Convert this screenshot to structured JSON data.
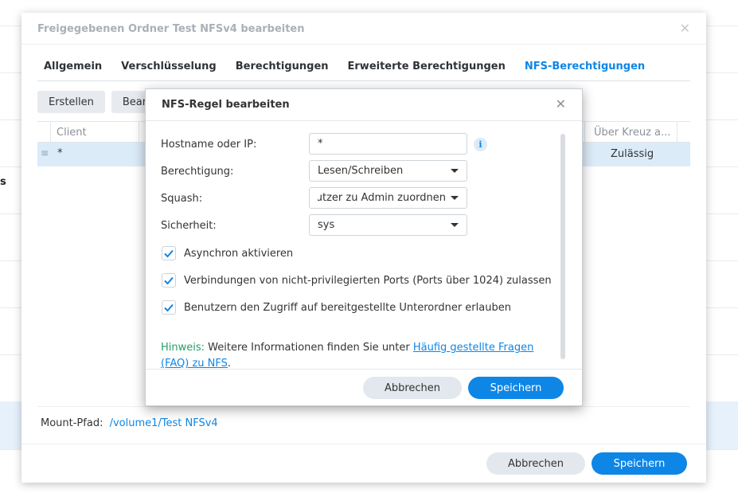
{
  "background": {
    "edge_text": "s"
  },
  "outer_dialog": {
    "title": "Freigegebenen Ordner Test NFSv4 bearbeiten",
    "close_glyph": "✕",
    "tabs": [
      {
        "label": "Allgemein",
        "active": false
      },
      {
        "label": "Verschlüsselung",
        "active": false
      },
      {
        "label": "Berechtigungen",
        "active": false
      },
      {
        "label": "Erweiterte Berechtigungen",
        "active": false
      },
      {
        "label": "NFS-Berechtigungen",
        "active": true
      }
    ],
    "toolbar": {
      "create_label": "Erstellen",
      "edit_label": "Bearb"
    },
    "grid": {
      "col_client": "Client",
      "col_cross": "Über Kreuz a...",
      "rows": [
        {
          "client": "*",
          "cross": "Zulässig"
        }
      ]
    },
    "mount": {
      "label": "Mount-Pfad:",
      "path": "/volume1/Test NFSv4"
    },
    "cancel_label": "Abbrechen",
    "save_label": "Speichern"
  },
  "modal": {
    "title": "NFS-Regel bearbeiten",
    "close_glyph": "✕",
    "hostname_label": "Hostname oder IP:",
    "hostname_value": "*",
    "info_glyph": "i",
    "permission_label": "Berechtigung:",
    "permission_value": "Lesen/Schreiben",
    "squash_label": "Squash:",
    "squash_value": "Alle Benutzer zu Admin zuordnen",
    "security_label": "Sicherheit:",
    "security_value": "sys",
    "checkboxes": [
      {
        "label": "Asynchron aktivieren",
        "checked": true
      },
      {
        "label": "Verbindungen von nicht-privilegierten Ports (Ports über 1024) zulassen",
        "checked": true
      },
      {
        "label": "Benutzern den Zugriff auf bereitgestellte Unterordner erlauben",
        "checked": true
      }
    ],
    "hint_key": "Hinweis:",
    "hint_text": " Weitere Informationen finden Sie unter ",
    "hint_link": "Häufig gestellte Fragen (FAQ) zu NFS",
    "hint_end": ".",
    "cancel_label": "Abbrechen",
    "save_label": "Speichern"
  },
  "colors": {
    "accent": "#0e86e6",
    "hint_green": "#22a06b",
    "selected_row": "#dcebf8"
  }
}
